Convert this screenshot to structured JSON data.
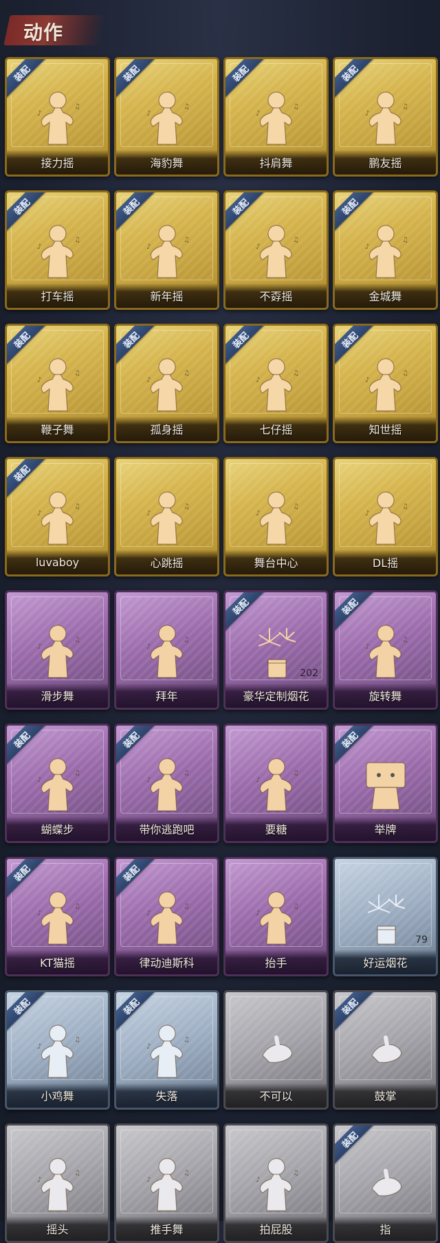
{
  "header": {
    "title": "动作"
  },
  "equipped_label": "装配",
  "cards": [
    {
      "label": "接力摇",
      "tier": "gold",
      "equipped": true,
      "icon": "dance-figure-icon"
    },
    {
      "label": "海豹舞",
      "tier": "gold",
      "equipped": true,
      "icon": "dance-figure-icon"
    },
    {
      "label": "抖肩舞",
      "tier": "gold",
      "equipped": true,
      "icon": "dance-figure-icon"
    },
    {
      "label": "鹏友摇",
      "tier": "gold",
      "equipped": true,
      "icon": "dance-figure-icon"
    },
    {
      "label": "打车摇",
      "tier": "gold",
      "equipped": true,
      "icon": "dance-figure-icon"
    },
    {
      "label": "新年摇",
      "tier": "gold",
      "equipped": true,
      "icon": "dance-figure-icon"
    },
    {
      "label": "不孬摇",
      "tier": "gold",
      "equipped": true,
      "icon": "dance-figure-icon"
    },
    {
      "label": "金城舞",
      "tier": "gold",
      "equipped": true,
      "icon": "dance-figure-icon"
    },
    {
      "label": "鞭子舞",
      "tier": "gold",
      "equipped": true,
      "icon": "dance-figure-icon"
    },
    {
      "label": "孤身摇",
      "tier": "gold",
      "equipped": true,
      "icon": "dance-figure-icon"
    },
    {
      "label": "七仔摇",
      "tier": "gold",
      "equipped": true,
      "icon": "dance-figure-icon"
    },
    {
      "label": "知世摇",
      "tier": "gold",
      "equipped": true,
      "icon": "dance-figure-icon"
    },
    {
      "label": "luvaboy",
      "tier": "gold",
      "equipped": true,
      "icon": "dance-figure-icon"
    },
    {
      "label": "心跳摇",
      "tier": "gold",
      "equipped": false,
      "icon": "dance-figure-icon"
    },
    {
      "label": "舞台中心",
      "tier": "gold",
      "equipped": false,
      "icon": "dance-figure-icon"
    },
    {
      "label": "DL摇",
      "tier": "gold",
      "equipped": false,
      "icon": "dance-figure-icon"
    },
    {
      "label": "滑步舞",
      "tier": "purple",
      "equipped": false,
      "icon": "dance-figure-icon"
    },
    {
      "label": "拜年",
      "tier": "purple",
      "equipped": false,
      "icon": "bow-figure-icon"
    },
    {
      "label": "豪华定制烟花",
      "tier": "purple",
      "equipped": true,
      "icon": "fireworks-icon",
      "count": "202"
    },
    {
      "label": "旋转舞",
      "tier": "purple",
      "equipped": true,
      "icon": "dance-figure-icon"
    },
    {
      "label": "蝴蝶步",
      "tier": "purple",
      "equipped": true,
      "icon": "dance-figure-icon"
    },
    {
      "label": "带你逃跑吧",
      "tier": "purple",
      "equipped": true,
      "icon": "dance-figure-icon"
    },
    {
      "label": "要糖",
      "tier": "purple",
      "equipped": false,
      "icon": "figure-icon"
    },
    {
      "label": "举牌",
      "tier": "purple",
      "equipped": true,
      "icon": "sign-figure-icon"
    },
    {
      "label": "KT猫摇",
      "tier": "purple",
      "equipped": true,
      "icon": "dance-figure-icon"
    },
    {
      "label": "律动迪斯科",
      "tier": "purple",
      "equipped": true,
      "icon": "dance-figure-icon"
    },
    {
      "label": "抬手",
      "tier": "purple",
      "equipped": false,
      "icon": "figure-icon"
    },
    {
      "label": "好运烟花",
      "tier": "blue",
      "equipped": false,
      "icon": "fireworks-icon",
      "count": "79"
    },
    {
      "label": "小鸡舞",
      "tier": "blue",
      "equipped": true,
      "icon": "dance-figure-icon"
    },
    {
      "label": "失落",
      "tier": "blue",
      "equipped": true,
      "icon": "kneel-figure-icon"
    },
    {
      "label": "不可以",
      "tier": "gray",
      "equipped": false,
      "icon": "finger-icon"
    },
    {
      "label": "鼓掌",
      "tier": "gray",
      "equipped": true,
      "icon": "clap-icon"
    },
    {
      "label": "摇头",
      "tier": "gray",
      "equipped": false,
      "icon": "figure-icon"
    },
    {
      "label": "推手舞",
      "tier": "gray",
      "equipped": false,
      "icon": "figure-icon"
    },
    {
      "label": "拍屁股",
      "tier": "gray",
      "equipped": false,
      "icon": "figure-icon"
    },
    {
      "label": "指",
      "tier": "gray",
      "equipped": true,
      "icon": "pointing-hand-icon"
    }
  ],
  "colors": {
    "gold_figure": "#f5d7a8",
    "purple_figure": "#f3d3a6",
    "blue_figure": "#e8eef6",
    "gray_figure": "#eaeaee",
    "badge": "#2c426a"
  }
}
